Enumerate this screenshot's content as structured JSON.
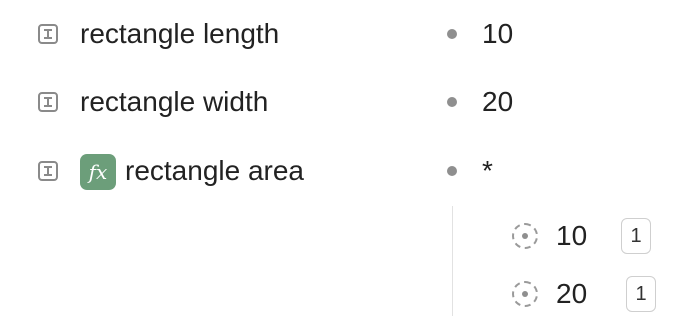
{
  "properties": [
    {
      "name": "rectangle length",
      "icon": "text-property-icon",
      "value": "10"
    },
    {
      "name": "rectangle width",
      "icon": "text-property-icon",
      "value": "20"
    },
    {
      "name": "rectangle area",
      "icon": "text-property-icon",
      "formula_badge": "fx",
      "value": "*"
    }
  ],
  "operands": [
    {
      "icon": "reference-icon",
      "value": "10",
      "count": "1"
    },
    {
      "icon": "reference-icon",
      "value": "20",
      "count": "1"
    }
  ],
  "colors": {
    "formula_badge_bg": "#6c9e7a",
    "icon_gray": "#8a8a8a",
    "text": "#222222"
  }
}
